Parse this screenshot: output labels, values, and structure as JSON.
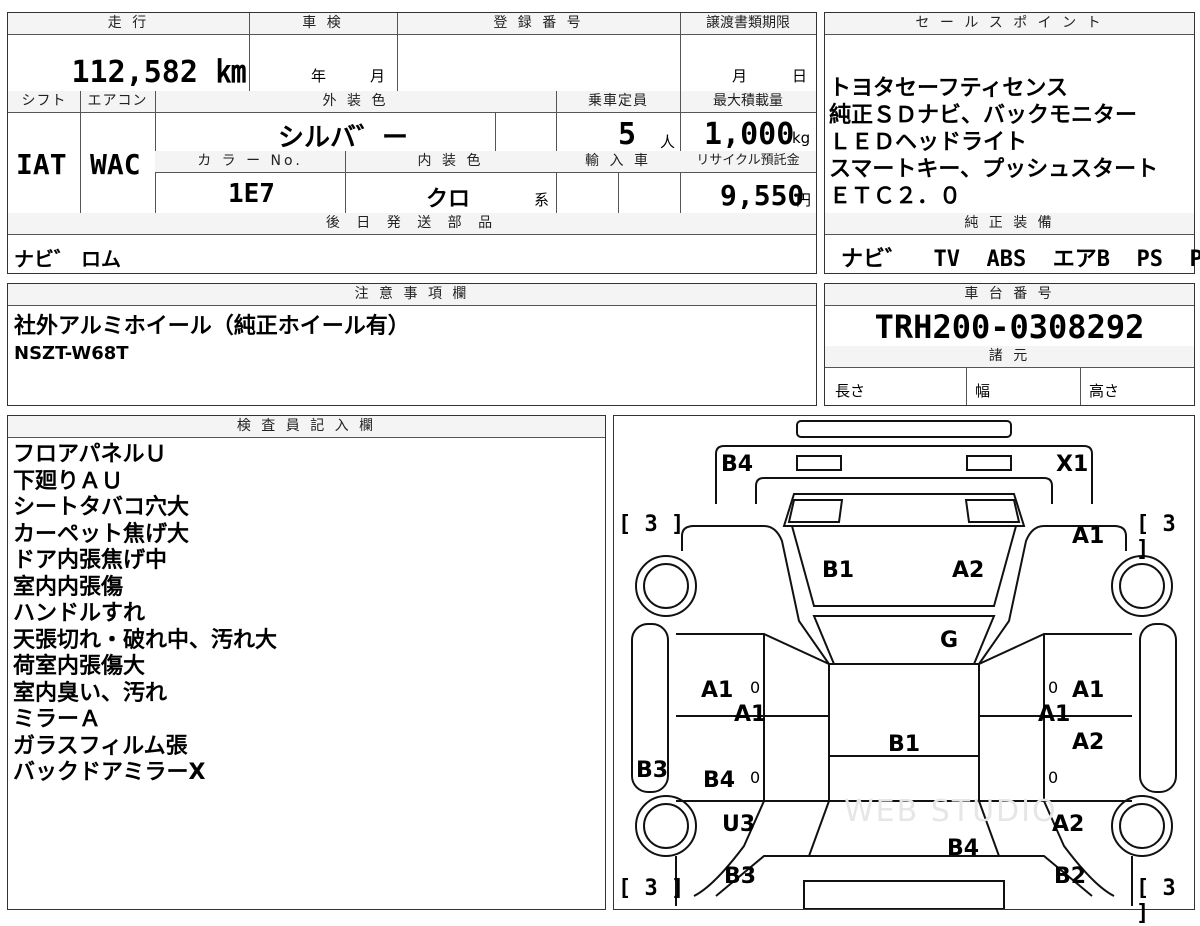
{
  "top": {
    "mileage_header": "走 行",
    "mileage_value": "112,582 ㎞",
    "inspection_header": "車 検",
    "inspection_year": "年",
    "inspection_month": "月",
    "registration_header": "登 録 番 号",
    "deadline_header": "譲渡書類期限",
    "deadline_month": "月",
    "deadline_day": "日",
    "shift_header": "シフト",
    "shift_value": "IAT",
    "ac_header": "エアコン",
    "ac_value": "WAC",
    "exterior_header": "外 装 色",
    "exterior_value": "シルバ゛ー",
    "capacity_header": "乗車定員",
    "capacity_value": "5",
    "capacity_unit": "人",
    "load_header": "最大積載量",
    "load_value": "1,000",
    "load_unit": "kg",
    "color_no_header": "カ ラ ー No.",
    "color_no_value": "1E7",
    "interior_header": "内 装 色",
    "interior_value": "クロ",
    "interior_suffix": "系",
    "import_header": "輸 入 車",
    "recycle_header": "リサイクル預託金",
    "recycle_value": "9,550",
    "recycle_unit": "円",
    "parts_header": "後 日 発 送 部 品",
    "parts_value": "ナビ゛ ロム"
  },
  "sales": {
    "header": "セ ー ル ス ポ イ ン ト",
    "lines": [
      "トヨタセーフティセンス",
      "純正ＳＤナビ、バックモニター",
      "ＬＥＤヘッドライト",
      "スマートキー、プッシュスタート",
      "ＥＴＣ２．０"
    ],
    "equipment_header": "純 正 装 備",
    "equipment_items": [
      "ナビ゛",
      "TV",
      "ABS",
      "エアB",
      "PS",
      "PW"
    ]
  },
  "caution": {
    "header": "注 意 事 項 欄",
    "lines": [
      "社外アルミホイール（純正ホイール有）",
      "NSZT-W68T"
    ]
  },
  "chassis": {
    "header": "車 台 番 号",
    "value": "TRH200-0308292",
    "spec_header": "諸 元",
    "length_label": "長さ",
    "width_label": "幅",
    "height_label": "高さ"
  },
  "inspector": {
    "header": "検 査 員 記 入 欄",
    "lines": [
      "フロアパネルＵ",
      "下廻りＡＵ",
      "シートタバコ穴大",
      "カーペット焦げ大",
      "ドア内張焦げ中",
      "室内内張傷",
      "ハンドルすれ",
      "天張切れ・破れ中、汚れ大",
      "荷室内張傷大",
      "室内臭い、汚れ",
      "ミラーＡ",
      "ガラスフィルム張",
      "バックドアミラーX"
    ]
  },
  "diagram": {
    "tire_ratings": [
      "[ 3 ]",
      "[ 3 ]",
      "[ 3 ]",
      "[ 3 ]"
    ],
    "labels": {
      "b4_top": "B4",
      "x1_top": "X1",
      "a1_right_top": "A1",
      "b1_hood": "B1",
      "a2_hood": "A2",
      "g_glass": "G",
      "a1_left_door": "A1",
      "a1_left_door2": "A1",
      "a1_right_door": "A1",
      "a1_right_door2": "A1",
      "a2_right": "A2",
      "b1_roof": "B1",
      "b3_left": "B3",
      "b4_left": "B4",
      "u3_left": "U3",
      "a2_right_low": "A2",
      "b4_rear": "B4",
      "b3_rear": "B3",
      "b2_rear": "B2"
    },
    "zero": "0",
    "watermark": "WEB STUDIO"
  }
}
